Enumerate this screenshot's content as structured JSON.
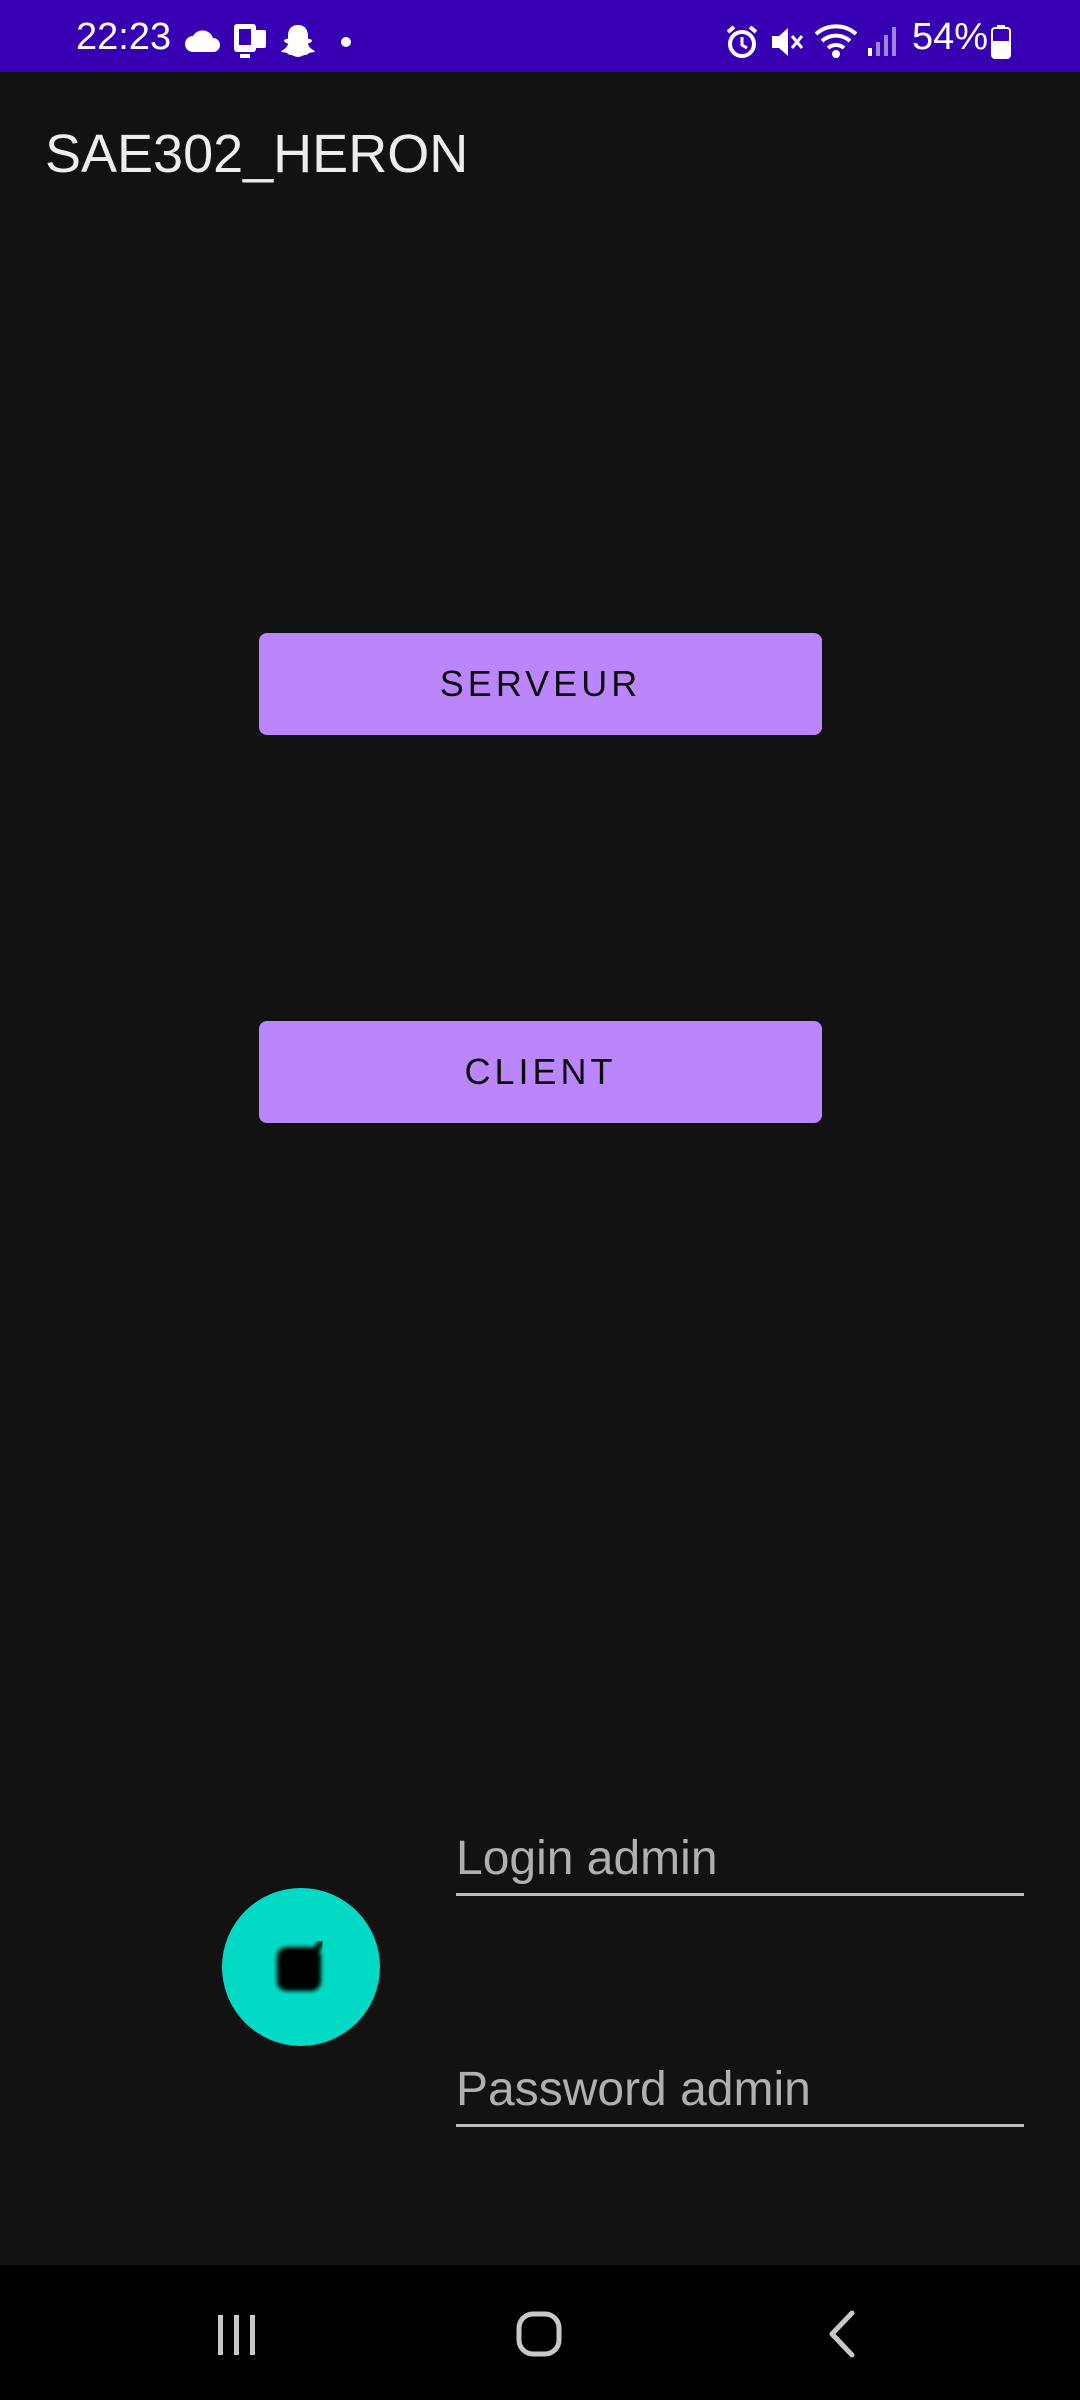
{
  "status_bar": {
    "time": "22:23",
    "battery_percent": "54%",
    "icons_left": [
      "cloud-icon",
      "device-icon",
      "snapchat-icon",
      "notification-dot-icon"
    ],
    "icons_right": [
      "alarm-icon",
      "mute-icon",
      "wifi-icon",
      "signal-icon",
      "battery-icon"
    ],
    "color": "#3700b3"
  },
  "app_bar": {
    "title": "SAE302_HERON"
  },
  "main": {
    "serveur_label": "SERVEUR",
    "client_label": "CLIENT",
    "button_color": "#bb86fc"
  },
  "admin": {
    "fab_color": "#03dac5",
    "fab_icon": "stop-square-icon",
    "login_placeholder": "Login admin",
    "login_value": "",
    "password_placeholder": "Password admin",
    "password_value": ""
  },
  "nav_bar": {
    "buttons": [
      "recents-icon",
      "home-icon",
      "back-icon"
    ]
  }
}
